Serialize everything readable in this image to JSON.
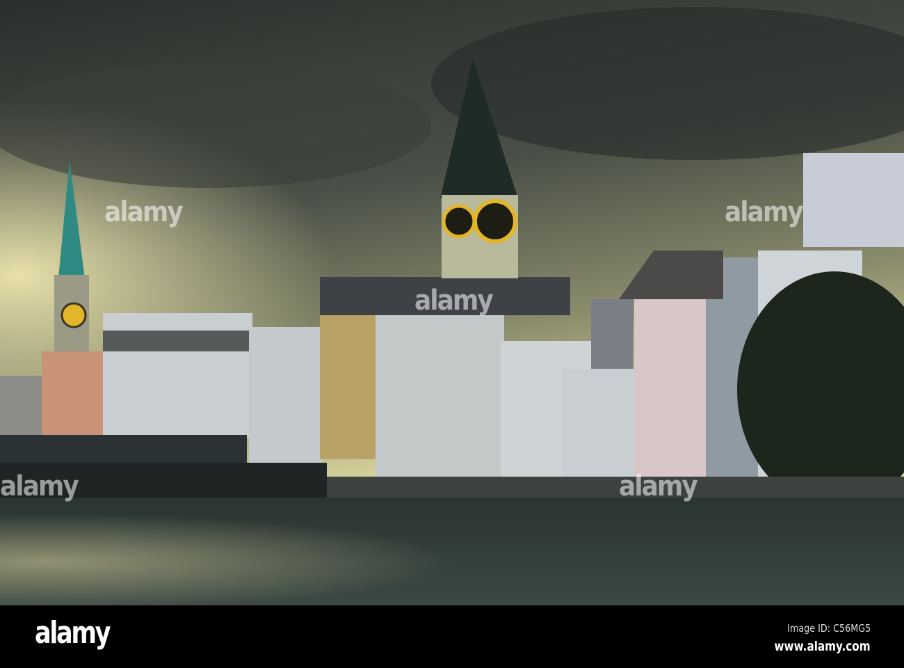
{
  "photo": {
    "subject": "Zurich old town riverside with church towers under stormy sky",
    "watermark_text": "alamy",
    "colors": {
      "sky_top": "#2c312e",
      "sky_mid": "#5b6053",
      "sky_glow": "#dcd79c",
      "water": "#33403c",
      "spire": "#2f8a83",
      "clock": "#e2b62a"
    }
  },
  "footer": {
    "logo": "alamy",
    "image_id": "Image ID: C56MG5",
    "url": "www.alamy.com"
  }
}
